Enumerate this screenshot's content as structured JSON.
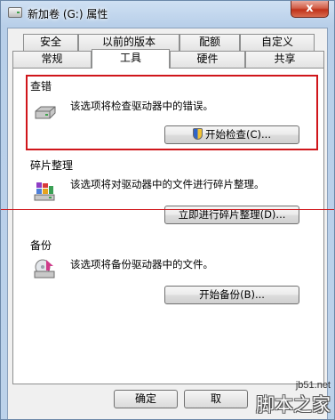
{
  "window": {
    "title": "新加卷 (G:) 属性",
    "close_label": "x"
  },
  "tabs": {
    "row1": [
      "安全",
      "以前的版本",
      "配额",
      "自定义"
    ],
    "row2": [
      "常规",
      "工具",
      "硬件",
      "共享"
    ],
    "active": "工具"
  },
  "groups": {
    "check": {
      "label": "查错",
      "description": "该选项将检查驱动器中的错误。",
      "button_label": "开始检查(C)...",
      "icon": "drive-icon"
    },
    "defrag": {
      "label": "碎片整理",
      "description": "该选项将对驱动器中的文件进行碎片整理。",
      "button_label": "立即进行碎片整理(D)...",
      "icon": "defrag-icon"
    },
    "backup": {
      "label": "备份",
      "description": "该选项将备份驱动器中的文件。",
      "button_label": "开始备份(B)...",
      "icon": "backup-icon"
    }
  },
  "footer": {
    "ok_label": "确定",
    "cancel_label": "取"
  },
  "watermark": {
    "domain": "jb51.net",
    "name": "脚本之家"
  },
  "colors": {
    "annotation": "#d0161b",
    "title_bar": "#b8cfe9"
  }
}
